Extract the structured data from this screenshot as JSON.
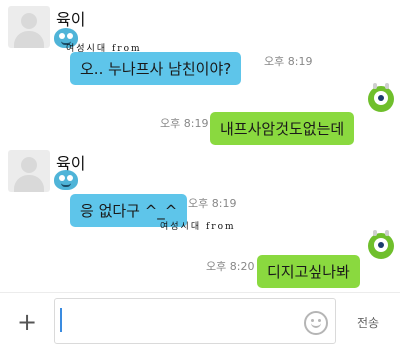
{
  "messages": [
    {
      "sender": "육이",
      "tag": "여성시대 from",
      "text": "오.. 누나프사 남친이야?",
      "time": "오후 8:19"
    },
    {
      "text": "내프사암것도없는데",
      "time": "오후 8:19"
    },
    {
      "sender": "육이",
      "tag": "여성시대 from",
      "text": "응 없다구 ^_^",
      "time": "오후 8:19"
    },
    {
      "text": "디지고싶나봐",
      "time": "오후 8:20"
    }
  ],
  "input": {
    "placeholder": "",
    "send_label": "전송"
  },
  "icons": {
    "attach": "plus-icon",
    "emoticon": "smiley-icon"
  }
}
